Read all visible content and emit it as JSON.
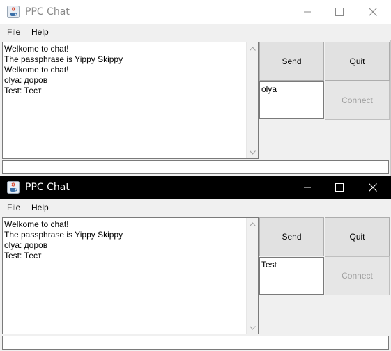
{
  "windows": [
    {
      "title": "PPC Chat",
      "theme": "inactive",
      "menu": {
        "file": "File",
        "help": "Help"
      },
      "messages": [
        "Welkome to chat!",
        "The passphrase is Yippy Skippy",
        "Welkome to chat!",
        "olya: доров",
        "Test: Тест"
      ],
      "buttons": {
        "send": "Send",
        "quit": "Quit",
        "connect": "Connect"
      },
      "name_field": "olya",
      "input_value": ""
    },
    {
      "title": "PPC Chat",
      "theme": "active",
      "menu": {
        "file": "File",
        "help": "Help"
      },
      "messages": [
        "Welkome to chat!",
        "The passphrase is Yippy Skippy",
        "olya: доров",
        "Test: Тест"
      ],
      "buttons": {
        "send": "Send",
        "quit": "Quit",
        "connect": "Connect"
      },
      "name_field": "Test",
      "input_value": ""
    }
  ],
  "colors": {
    "inactive_titlebar_bg": "#ffffff",
    "active_titlebar_bg": "#000000",
    "disabled_text": "#a0a0a0"
  },
  "icons": [
    "java-cup-icon",
    "minimize-icon",
    "maximize-icon",
    "close-icon",
    "scroll-up-arrow-icon",
    "scroll-down-arrow-icon"
  ]
}
